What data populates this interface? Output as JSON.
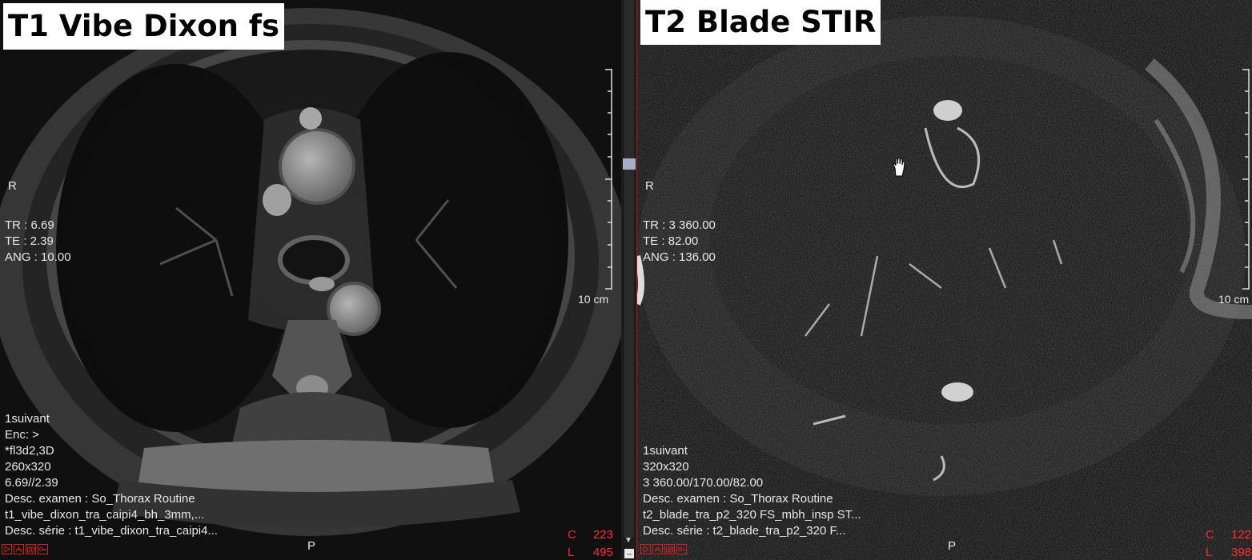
{
  "left_viewport": {
    "title": "T1 Vibe Dixon fs",
    "orientation_right": "R",
    "orientation_bottom": "P",
    "params": [
      "TR : 6.69",
      "TE : 2.39",
      "ANG : 10.00"
    ],
    "info": [
      "1suivant",
      "Enc: >",
      "*fl3d2,3D",
      "260x320",
      "6.69//2.39",
      "Desc. examen : So_Thorax Routine",
      "t1_vibe_dixon_tra_caipi4_bh_3mm,...",
      "Desc. série :  t1_vibe_dixon_tra_caipi4..."
    ],
    "scale_label": "10 cm",
    "window_center_label": "C",
    "window_center": "223",
    "window_level_label": "L",
    "window_level": "495"
  },
  "right_viewport": {
    "title": "T2 Blade STIR",
    "orientation_right": "R",
    "orientation_bottom": "P",
    "params": [
      "TR : 3 360.00",
      "TE : 82.00",
      "ANG : 136.00"
    ],
    "info": [
      "1suivant",
      "320x320",
      "3 360.00/170.00/82.00",
      "Desc. examen : So_Thorax Routine",
      "t2_blade_tra_p2_320 FS_mbh_insp ST...",
      "Desc. série :  t2_blade_tra_p2_320 F..."
    ],
    "scale_label": "10 cm",
    "window_center_label": "C",
    "window_center": "122",
    "window_level_label": "L",
    "window_level": "398"
  },
  "toolbar_icons": [
    "play-icon",
    "flip-icon",
    "camera-icon",
    "key-icon"
  ]
}
